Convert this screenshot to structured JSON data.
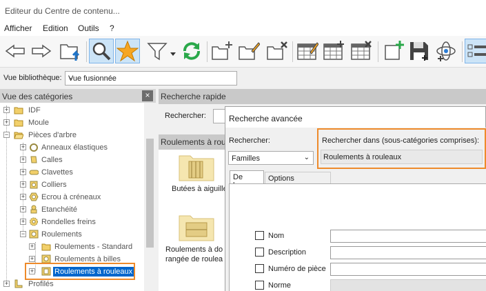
{
  "window": {
    "title": "Editeur du Centre de contenu..."
  },
  "menu": {
    "items": [
      "Afficher",
      "Edition",
      "Outils",
      "?"
    ]
  },
  "toolbar": {
    "buttons": [
      "back-arrow",
      "forward-arrow",
      "folder-up",
      "search",
      "favorites",
      "filter",
      "refresh",
      "new-category",
      "edit-category",
      "delete-category",
      "table-edit",
      "table-add",
      "table-delete",
      "add-member",
      "save",
      "publish",
      "tree-view"
    ],
    "active": [
      "search",
      "tree-view"
    ]
  },
  "library": {
    "label": "Vue bibliothèque:",
    "selected": "Vue fusionnée"
  },
  "categories": {
    "title": "Vue des catégories",
    "close": "×",
    "tree": [
      {
        "label": "IDF",
        "level": 0,
        "expander": "+"
      },
      {
        "label": "Moule",
        "level": 0,
        "expander": "+"
      },
      {
        "label": "Pièces d'arbre",
        "level": 0,
        "expander": "−"
      },
      {
        "label": "Anneaux élastiques",
        "level": 1,
        "expander": "+"
      },
      {
        "label": "Calles",
        "level": 1,
        "expander": "+"
      },
      {
        "label": "Clavettes",
        "level": 1,
        "expander": "+"
      },
      {
        "label": "Colliers",
        "level": 1,
        "expander": "+"
      },
      {
        "label": "Ecrou à créneaux",
        "level": 1,
        "expander": "+"
      },
      {
        "label": "Etanchéité",
        "level": 1,
        "expander": "+"
      },
      {
        "label": "Rondelles freins",
        "level": 1,
        "expander": "+"
      },
      {
        "label": "Roulements",
        "level": 1,
        "expander": "−"
      },
      {
        "label": "Roulements - Standard",
        "level": 2,
        "expander": "+"
      },
      {
        "label": "Roulements à billes",
        "level": 2,
        "expander": "+"
      },
      {
        "label": "Roulements à rouleaux",
        "level": 2,
        "expander": "+",
        "selected": true
      },
      {
        "label": "Profilés",
        "level": 0,
        "expander": "+"
      }
    ]
  },
  "quick_search": {
    "title": "Recherche rapide",
    "label": "Rechercher:"
  },
  "results": {
    "title": "Roulements à rouleaux",
    "items": [
      {
        "line1": "Butées à aiguille",
        "line2": ""
      },
      {
        "line1": "Roulements à do",
        "line2": "rangée de roulea"
      }
    ]
  },
  "advanced": {
    "title": "Recherche avancée",
    "search_label": "Rechercher:",
    "search_value": "Familles",
    "scope_label": "Rechercher dans (sous-catégories comprises):",
    "scope_value": "Roulements à rouleaux",
    "tabs": [
      "De base",
      "Options avancées"
    ],
    "fields": [
      {
        "label": "Nom",
        "disabled": false
      },
      {
        "label": "Description",
        "disabled": false
      },
      {
        "label": "Numéro de pièce",
        "disabled": false
      },
      {
        "label": "Norme",
        "disabled": true
      }
    ]
  },
  "colors": {
    "accent": "#ee8a2a",
    "selection": "#0066cc",
    "toolbar_active": "#cce4f7"
  }
}
